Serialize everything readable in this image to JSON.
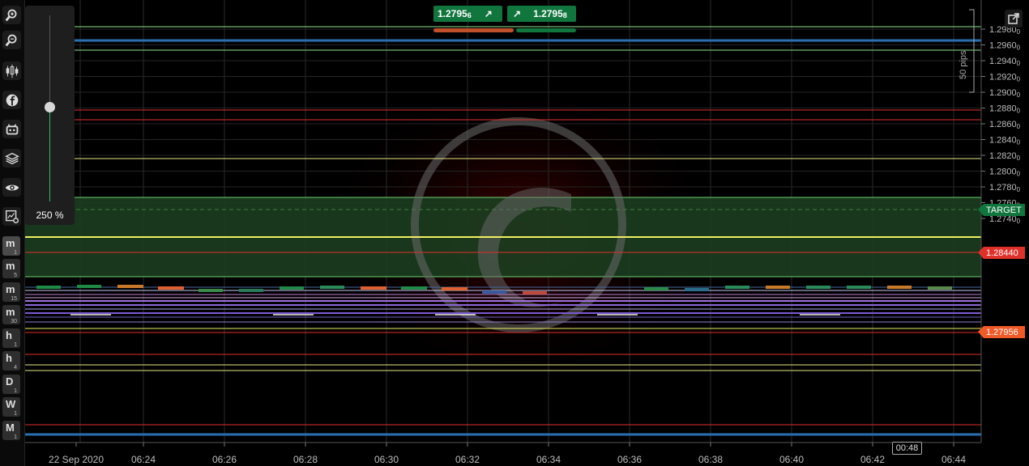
{
  "toolbar": {
    "tools": [
      {
        "icon": "zoom-in-icon"
      },
      {
        "icon": "zoom-out-icon"
      },
      {
        "icon": "candlestick-icon"
      },
      {
        "icon": "facebook-icon"
      },
      {
        "icon": "robot-icon"
      },
      {
        "icon": "layers-icon"
      },
      {
        "icon": "eye-icon"
      },
      {
        "icon": "chart-settings-icon"
      }
    ],
    "timeframes": [
      {
        "label": "m",
        "sub": "1",
        "active": true
      },
      {
        "label": "m",
        "sub": "5",
        "active": false
      },
      {
        "label": "m",
        "sub": "15",
        "active": false
      },
      {
        "label": "m",
        "sub": "30",
        "active": false
      },
      {
        "label": "h",
        "sub": "1",
        "active": false
      },
      {
        "label": "h",
        "sub": "4",
        "active": false
      },
      {
        "label": "D",
        "sub": "1",
        "active": false
      },
      {
        "label": "W",
        "sub": "1",
        "active": false
      },
      {
        "label": "M",
        "sub": "1",
        "active": false
      }
    ]
  },
  "zoom": {
    "label": "250 %",
    "level_fraction": 0.5
  },
  "quote": {
    "sell": {
      "price": "1.2795",
      "pip": "6"
    },
    "buy": {
      "price": "1.2795",
      "pip": "8"
    }
  },
  "scale_label": "50 pips",
  "y_axis": {
    "ticks": [
      {
        "price": 1.298,
        "main": "1.2980",
        "sub": "0"
      },
      {
        "price": 1.296,
        "main": "1.2960",
        "sub": "0"
      },
      {
        "price": 1.294,
        "main": "1.2940",
        "sub": "0"
      },
      {
        "price": 1.292,
        "main": "1.2920",
        "sub": "0"
      },
      {
        "price": 1.29,
        "main": "1.2900",
        "sub": "0"
      },
      {
        "price": 1.288,
        "main": "1.2880",
        "sub": "0"
      },
      {
        "price": 1.286,
        "main": "1.2860",
        "sub": "0"
      },
      {
        "price": 1.284,
        "main": "1.2840",
        "sub": "0"
      },
      {
        "price": 1.282,
        "main": "1.2820",
        "sub": "0"
      },
      {
        "price": 1.28,
        "main": "1.2800",
        "sub": "0"
      },
      {
        "price": 1.278,
        "main": "1.2780",
        "sub": "0"
      },
      {
        "price": 1.276,
        "main": "1.2760",
        "sub": "0"
      },
      {
        "price": 1.274,
        "main": "1.2740",
        "sub": "0"
      }
    ]
  },
  "x_axis": {
    "ticks": [
      "22 Sep 2020",
      "06:24",
      "06:26",
      "06:28",
      "06:30",
      "06:32",
      "06:34",
      "06:36",
      "06:38",
      "06:40",
      "06:42",
      "06:44"
    ]
  },
  "tags": {
    "target": "TARGET",
    "red_level": "1.28440",
    "current": "1.27956"
  },
  "time_badge": "00:48",
  "colors": {
    "green": "#11753e",
    "red_tag": "#e0302a",
    "orange_tag": "#f05a28",
    "target_zone": "#1b3d1f"
  }
}
